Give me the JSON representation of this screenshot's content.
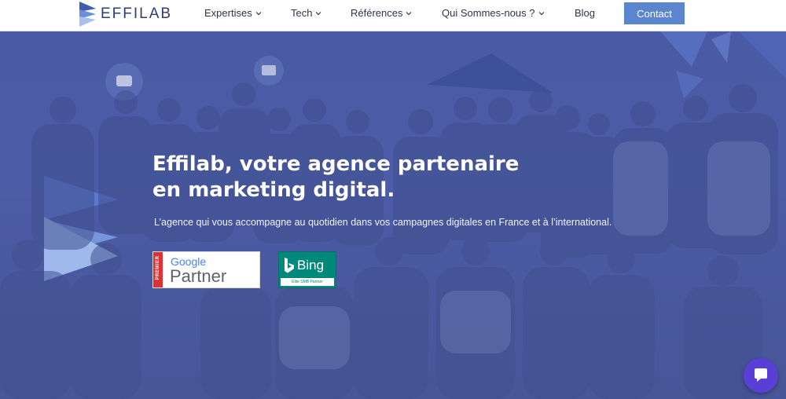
{
  "brand": {
    "name": "EFFILAB",
    "accent": "#5b86cf",
    "dark": "#2f3c6e"
  },
  "nav": {
    "items": [
      {
        "label": "Expertises",
        "has_dropdown": true
      },
      {
        "label": "Tech",
        "has_dropdown": true
      },
      {
        "label": "Références",
        "has_dropdown": true
      },
      {
        "label": "Qui Sommes-nous ?",
        "has_dropdown": true
      },
      {
        "label": "Blog",
        "has_dropdown": false
      }
    ],
    "cta": "Contact"
  },
  "hero": {
    "title_line1": "Effilab, votre agence partenaire",
    "title_line2": "en marketing digital.",
    "subtitle": "L’agence qui vous accompagne au quotidien dans vos campagnes digitales en France et à l’international.",
    "overlay_color": "#4a5aa5"
  },
  "badges": {
    "google": {
      "ribbon": "PREMIER",
      "brand": "Google",
      "label": "Partner"
    },
    "bing": {
      "brand": "Bing",
      "label": "Elite SMB Partner"
    }
  },
  "chat": {
    "icon": "chat-bubble-icon",
    "color": "#5a3fd6"
  }
}
